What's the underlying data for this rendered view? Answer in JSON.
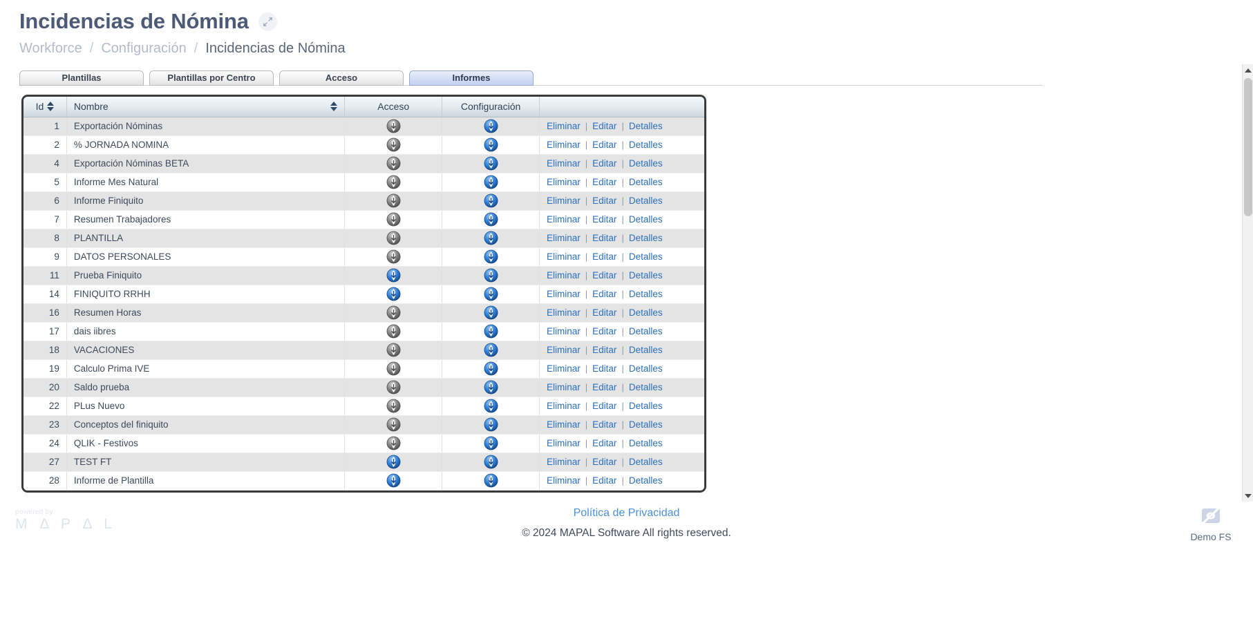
{
  "header": {
    "title": "Incidencias de Nómina",
    "expand_icon": "expand-arrows-icon"
  },
  "breadcrumb": {
    "items": [
      {
        "label": "Workforce"
      },
      {
        "label": "Configuración"
      },
      {
        "label": "Incidencias de Nómina"
      }
    ],
    "separator": "/"
  },
  "tabs": [
    {
      "label": "Plantillas",
      "active": false
    },
    {
      "label": "Plantillas por Centro",
      "active": false
    },
    {
      "label": "Acceso",
      "active": false
    },
    {
      "label": "Informes",
      "active": true
    }
  ],
  "table": {
    "columns": [
      {
        "key": "id",
        "label": "Id",
        "sortable": true
      },
      {
        "key": "nombre",
        "label": "Nombre",
        "sortable": true
      },
      {
        "key": "acceso",
        "label": "Acceso",
        "sortable": false
      },
      {
        "key": "configuracion",
        "label": "Configuración",
        "sortable": false
      },
      {
        "key": "actions",
        "label": "",
        "sortable": false
      }
    ],
    "actions": {
      "delete_label": "Eliminar",
      "edit_label": "Editar",
      "details_label": "Detalles",
      "separator": "|"
    },
    "icon_colors": {
      "active": "#2a7ad4",
      "inactive": "#7d7d7d"
    },
    "rows": [
      {
        "id": "1",
        "nombre": "Exportación Nóminas",
        "acceso": "inactive",
        "configuracion": "active"
      },
      {
        "id": "2",
        "nombre": "% JORNADA NOMINA",
        "acceso": "inactive",
        "configuracion": "active"
      },
      {
        "id": "4",
        "nombre": "Exportación Nóminas BETA",
        "acceso": "inactive",
        "configuracion": "active"
      },
      {
        "id": "5",
        "nombre": "Informe Mes Natural",
        "acceso": "inactive",
        "configuracion": "active"
      },
      {
        "id": "6",
        "nombre": "Informe Finiquito",
        "acceso": "inactive",
        "configuracion": "active"
      },
      {
        "id": "7",
        "nombre": "Resumen Trabajadores",
        "acceso": "inactive",
        "configuracion": "active"
      },
      {
        "id": "8",
        "nombre": "PLANTILLA",
        "acceso": "inactive",
        "configuracion": "active"
      },
      {
        "id": "9",
        "nombre": "DATOS PERSONALES",
        "acceso": "inactive",
        "configuracion": "active"
      },
      {
        "id": "11",
        "nombre": "Prueba Finiquito",
        "acceso": "active",
        "configuracion": "active"
      },
      {
        "id": "14",
        "nombre": "FINIQUITO RRHH",
        "acceso": "active",
        "configuracion": "active"
      },
      {
        "id": "16",
        "nombre": "Resumen Horas",
        "acceso": "inactive",
        "configuracion": "active"
      },
      {
        "id": "17",
        "nombre": "dais iibres",
        "acceso": "inactive",
        "configuracion": "active"
      },
      {
        "id": "18",
        "nombre": "VACACIONES",
        "acceso": "inactive",
        "configuracion": "active"
      },
      {
        "id": "19",
        "nombre": "Calculo Prima IVE",
        "acceso": "inactive",
        "configuracion": "active"
      },
      {
        "id": "20",
        "nombre": "Saldo prueba",
        "acceso": "inactive",
        "configuracion": "active"
      },
      {
        "id": "22",
        "nombre": "PLus Nuevo",
        "acceso": "inactive",
        "configuracion": "active"
      },
      {
        "id": "23",
        "nombre": "Conceptos del finiquito",
        "acceso": "inactive",
        "configuracion": "active"
      },
      {
        "id": "24",
        "nombre": "QLIK - Festivos",
        "acceso": "inactive",
        "configuracion": "active"
      },
      {
        "id": "27",
        "nombre": "TEST FT",
        "acceso": "active",
        "configuracion": "active"
      },
      {
        "id": "28",
        "nombre": "Informe de Plantilla",
        "acceso": "active",
        "configuracion": "active"
      }
    ]
  },
  "footer": {
    "powered_by": "powered by",
    "brand": "M Δ P Δ L",
    "privacy_link": "Política de Privacidad",
    "copyright": "© 2024 MAPAL Software All rights reserved.",
    "account_name": "Demo FS",
    "account_icon": "eye-slash-icon"
  },
  "scrollbar": {
    "up_icon": "caret-up-icon",
    "down_icon": "caret-down-icon"
  }
}
